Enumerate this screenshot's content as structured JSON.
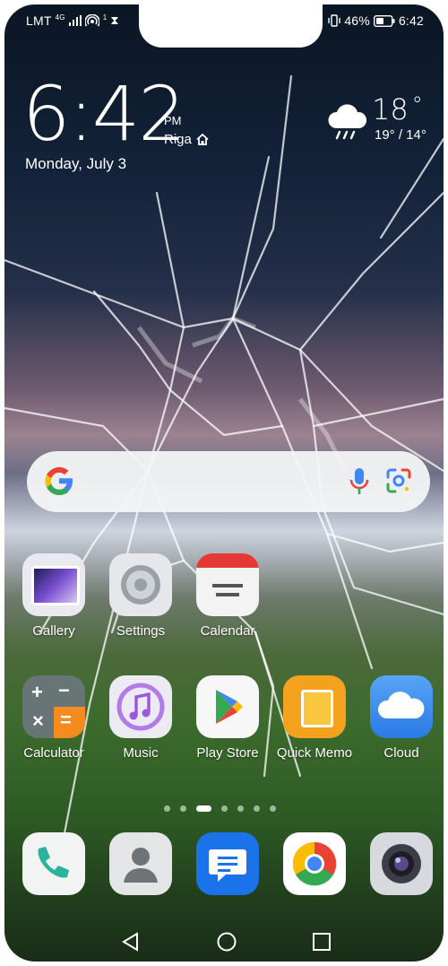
{
  "status": {
    "carrier": "LMT",
    "network": "4G",
    "hotspot_count": "1",
    "battery": "46%",
    "time": "6:42"
  },
  "clock_widget": {
    "time": "6:42",
    "ampm": "PM",
    "city": "Riga",
    "date": "Monday, July 3"
  },
  "weather": {
    "icon": "rain-cloud-icon",
    "temp": "18",
    "unit": "°",
    "range": "19° / 14°"
  },
  "search": {
    "icons": [
      "google-g-icon",
      "microphone-icon",
      "google-lens-icon"
    ]
  },
  "apps_row1": [
    {
      "label": "Gallery",
      "icon": "gallery-icon"
    },
    {
      "label": "Settings",
      "icon": "settings-icon"
    },
    {
      "label": "Calendar",
      "icon": "calendar-icon"
    }
  ],
  "apps_row2": [
    {
      "label": "Calculator",
      "icon": "calculator-icon"
    },
    {
      "label": "Music",
      "icon": "music-icon"
    },
    {
      "label": "Play Store",
      "icon": "play-store-icon"
    },
    {
      "label": "Quick Memo",
      "icon": "quick-memo-icon"
    },
    {
      "label": "Cloud",
      "icon": "cloud-icon"
    }
  ],
  "page_indicator": {
    "pages": 7,
    "active_index": 2
  },
  "dock": [
    {
      "icon": "phone-icon"
    },
    {
      "icon": "contacts-icon"
    },
    {
      "icon": "messages-icon"
    },
    {
      "icon": "chrome-icon"
    },
    {
      "icon": "camera-icon"
    }
  ],
  "navbar": {
    "icons": [
      "back-icon",
      "home-icon",
      "recents-icon"
    ]
  },
  "colors": {
    "accent_play": "#34a853",
    "memo": "#f4a21e",
    "cloud": "#3d8ef0",
    "messages": "#1a73e8"
  }
}
